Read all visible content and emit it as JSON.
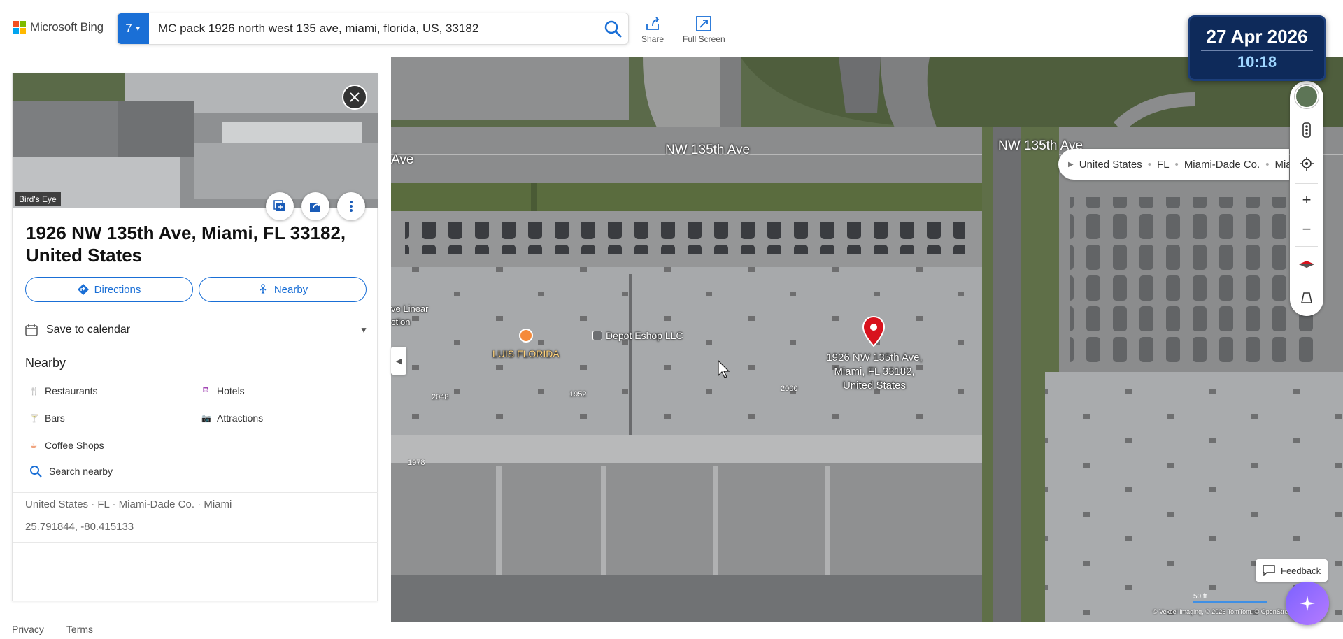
{
  "header": {
    "logo_text": "Microsoft Bing",
    "scope_label": "7",
    "query": "MC pack 1926 north west 135 ave, miami, florida, US, 33182",
    "share_label": "Share",
    "fullscreen_label": "Full Screen"
  },
  "clock": {
    "date": "27 Apr 2026",
    "time": "10:18"
  },
  "panel": {
    "photo_tag": "Bird's Eye",
    "title": "1926 NW 135th Ave, Miami, FL 33182, United States",
    "directions_label": "Directions",
    "nearby_btn_label": "Nearby",
    "calendar_label": "Save to calendar",
    "nearby_heading": "Nearby",
    "categories": [
      {
        "label": "Restaurants",
        "icon": "restaurant-icon"
      },
      {
        "label": "Hotels",
        "icon": "hotel-icon"
      },
      {
        "label": "Bars",
        "icon": "bar-icon"
      },
      {
        "label": "Attractions",
        "icon": "attraction-icon"
      },
      {
        "label": "Coffee Shops",
        "icon": "coffee-icon"
      }
    ],
    "search_nearby_label": "Search nearby",
    "breadcrumb": "United States · FL · Miami-Dade Co. · Miami",
    "coordinates": "25.791844, -80.415133"
  },
  "map": {
    "street_labels": [
      "NW 135th Ave",
      "NW 135th Ave",
      "Ave"
    ],
    "business_labels": [
      "Depot Eshop LLC",
      "LUIS FLORIDA",
      "ve Linear",
      "ction"
    ],
    "house_numbers": [
      "2048",
      "1952",
      "2000",
      "1978"
    ],
    "pin_label": "1926 NW 135th Ave,\nMiami, FL 33182,\nUnited States",
    "breadcrumb": [
      "United States",
      "FL",
      "Miami-Dade Co.",
      "Miami"
    ],
    "feedback_label": "Feedback",
    "scale_label": "50 ft",
    "copyright": "© Vexcel Imaging, © 2026 TomTom, © OpenStreetMap"
  },
  "footer": {
    "privacy": "Privacy",
    "terms": "Terms"
  },
  "colors": {
    "accent": "#1a6fd6",
    "pin": "#d8121d",
    "clock_bg": "#0e2a5a",
    "copilot": "#7b61ff"
  }
}
